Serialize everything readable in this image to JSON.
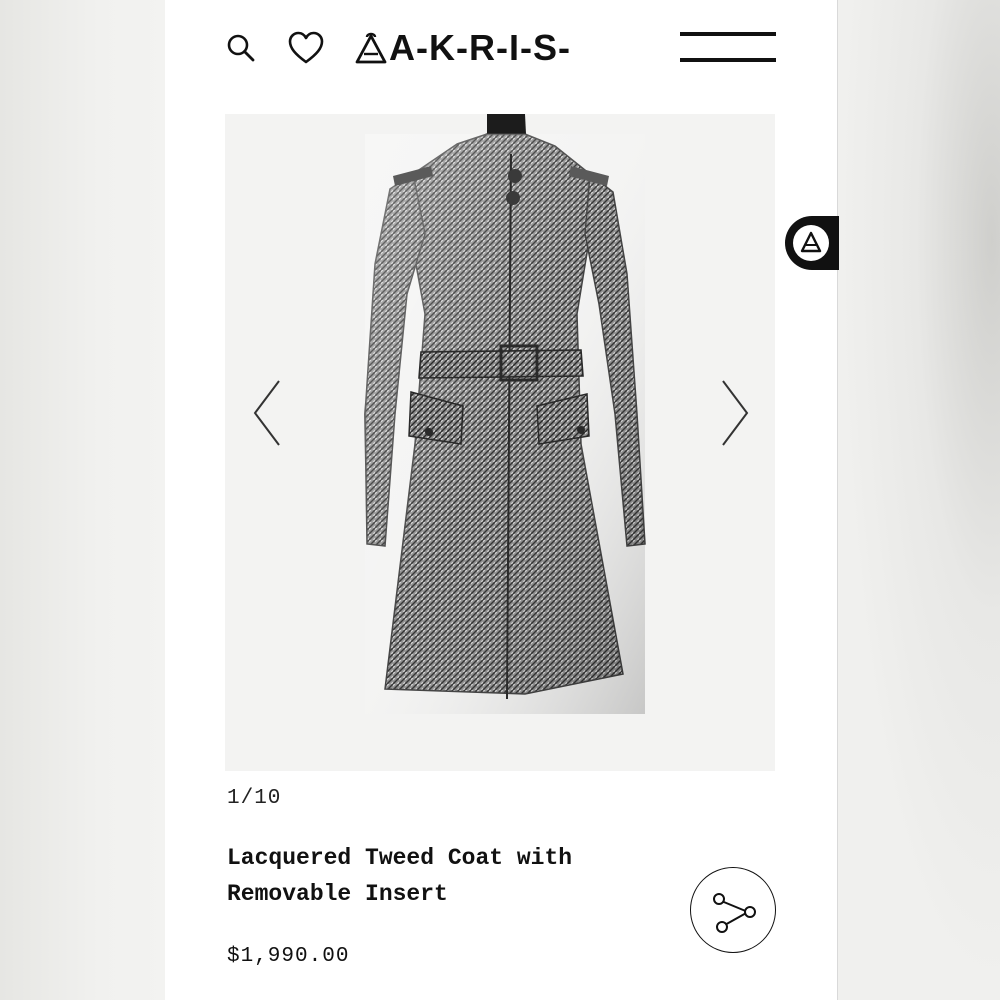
{
  "header": {
    "brand": "A-K-R-I-S-",
    "search_icon": "search-icon",
    "wishlist_icon": "heart-icon",
    "menu_icon": "hamburger-menu-icon"
  },
  "gallery": {
    "counter": "1/10",
    "prev_icon": "chevron-left-icon",
    "next_icon": "chevron-right-icon"
  },
  "product": {
    "title": "Lacquered Tweed Coat with Removable Insert",
    "price": "$1,990.00",
    "share_icon": "share-icon"
  },
  "float_badge": {
    "icon": "akris-a-icon"
  },
  "colors": {
    "ink": "#111111",
    "image_bg": "#f3f3f2",
    "page_bg": "#efefed"
  }
}
